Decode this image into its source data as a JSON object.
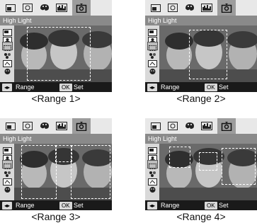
{
  "panels": [
    {
      "caption": "<Range 1>",
      "header_label": "High Light",
      "range_label": "Range",
      "ok_label": "OK",
      "set_label": "Set",
      "mode": 1
    },
    {
      "caption": "<Range 2>",
      "header_label": "High Light",
      "range_label": "Range",
      "ok_label": "OK",
      "set_label": "Set",
      "mode": 2
    },
    {
      "caption": "<Range 3>",
      "header_label": "High Light",
      "range_label": "Range",
      "ok_label": "OK",
      "set_label": "Set",
      "mode": 3
    },
    {
      "caption": "<Range 4>",
      "header_label": "High Light",
      "range_label": "Range",
      "ok_label": "OK",
      "set_label": "Set",
      "mode": 4
    }
  ],
  "toolbar_icons": [
    "frame-icon",
    "timer-icon",
    "palette-icon",
    "histogram-icon",
    "portrait-highlight-icon"
  ],
  "sidebar_icons": [
    "frame-icon",
    "portrait-icon",
    "range-select-icon",
    "color-dots-icon",
    "sharpen-icon",
    "face-icon"
  ],
  "colors": {
    "toolbar": "#e8e8e8",
    "header": "#8a8a8a",
    "bottom": "#1a1a1a",
    "selected_tool": "#9c9c9c"
  }
}
